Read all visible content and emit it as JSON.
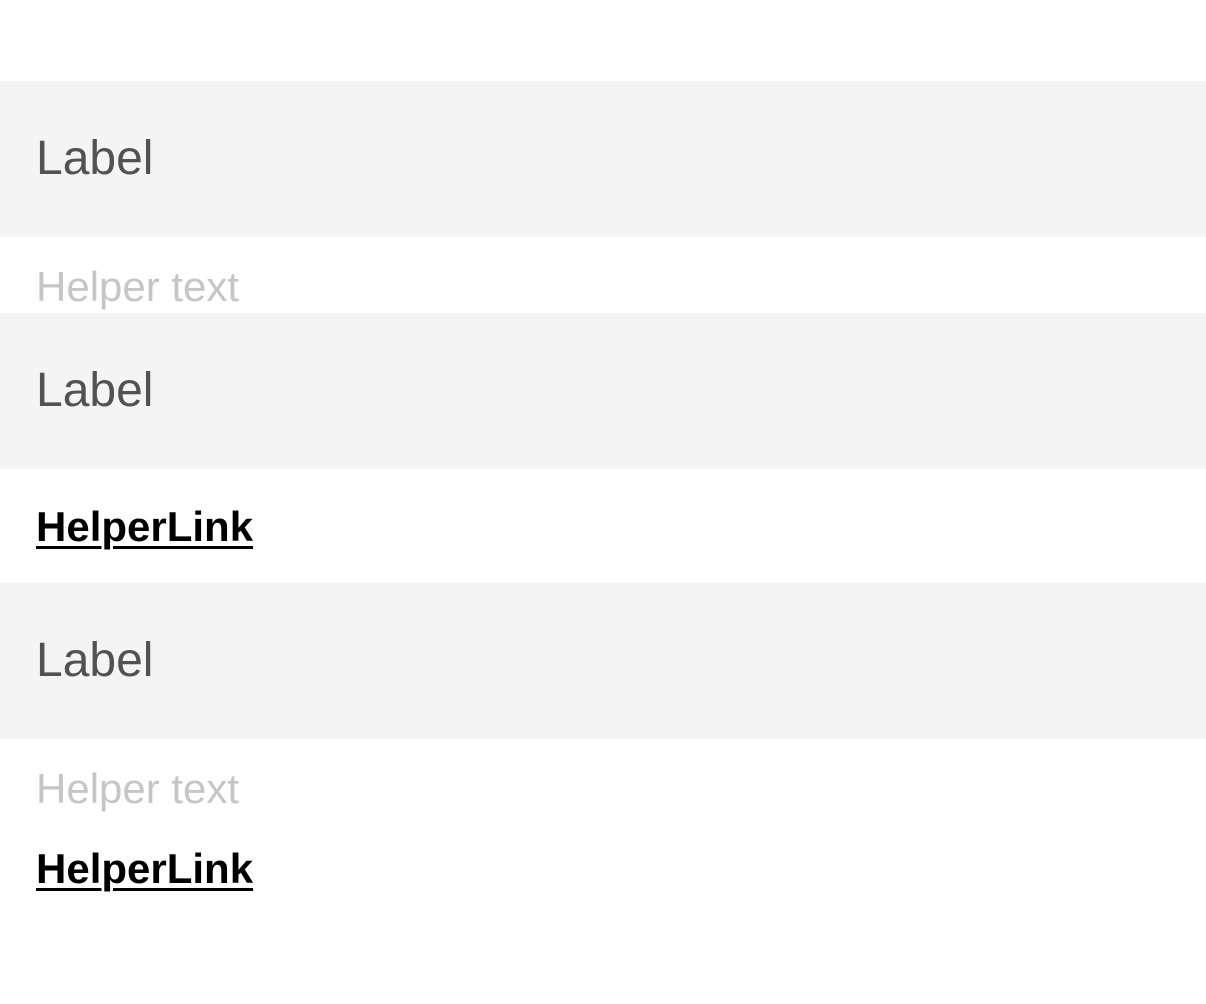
{
  "fields": [
    {
      "label": "Label",
      "helper_text": "Helper text"
    },
    {
      "label": "Label",
      "helper_link": "HelperLink"
    },
    {
      "label": "Label",
      "helper_text": "Helper text",
      "helper_link": "HelperLink"
    }
  ],
  "colors": {
    "field_background": "#f4f4f4",
    "label": "#525252",
    "helper_text": "#c6c6c6",
    "helper_link": "#000000"
  }
}
